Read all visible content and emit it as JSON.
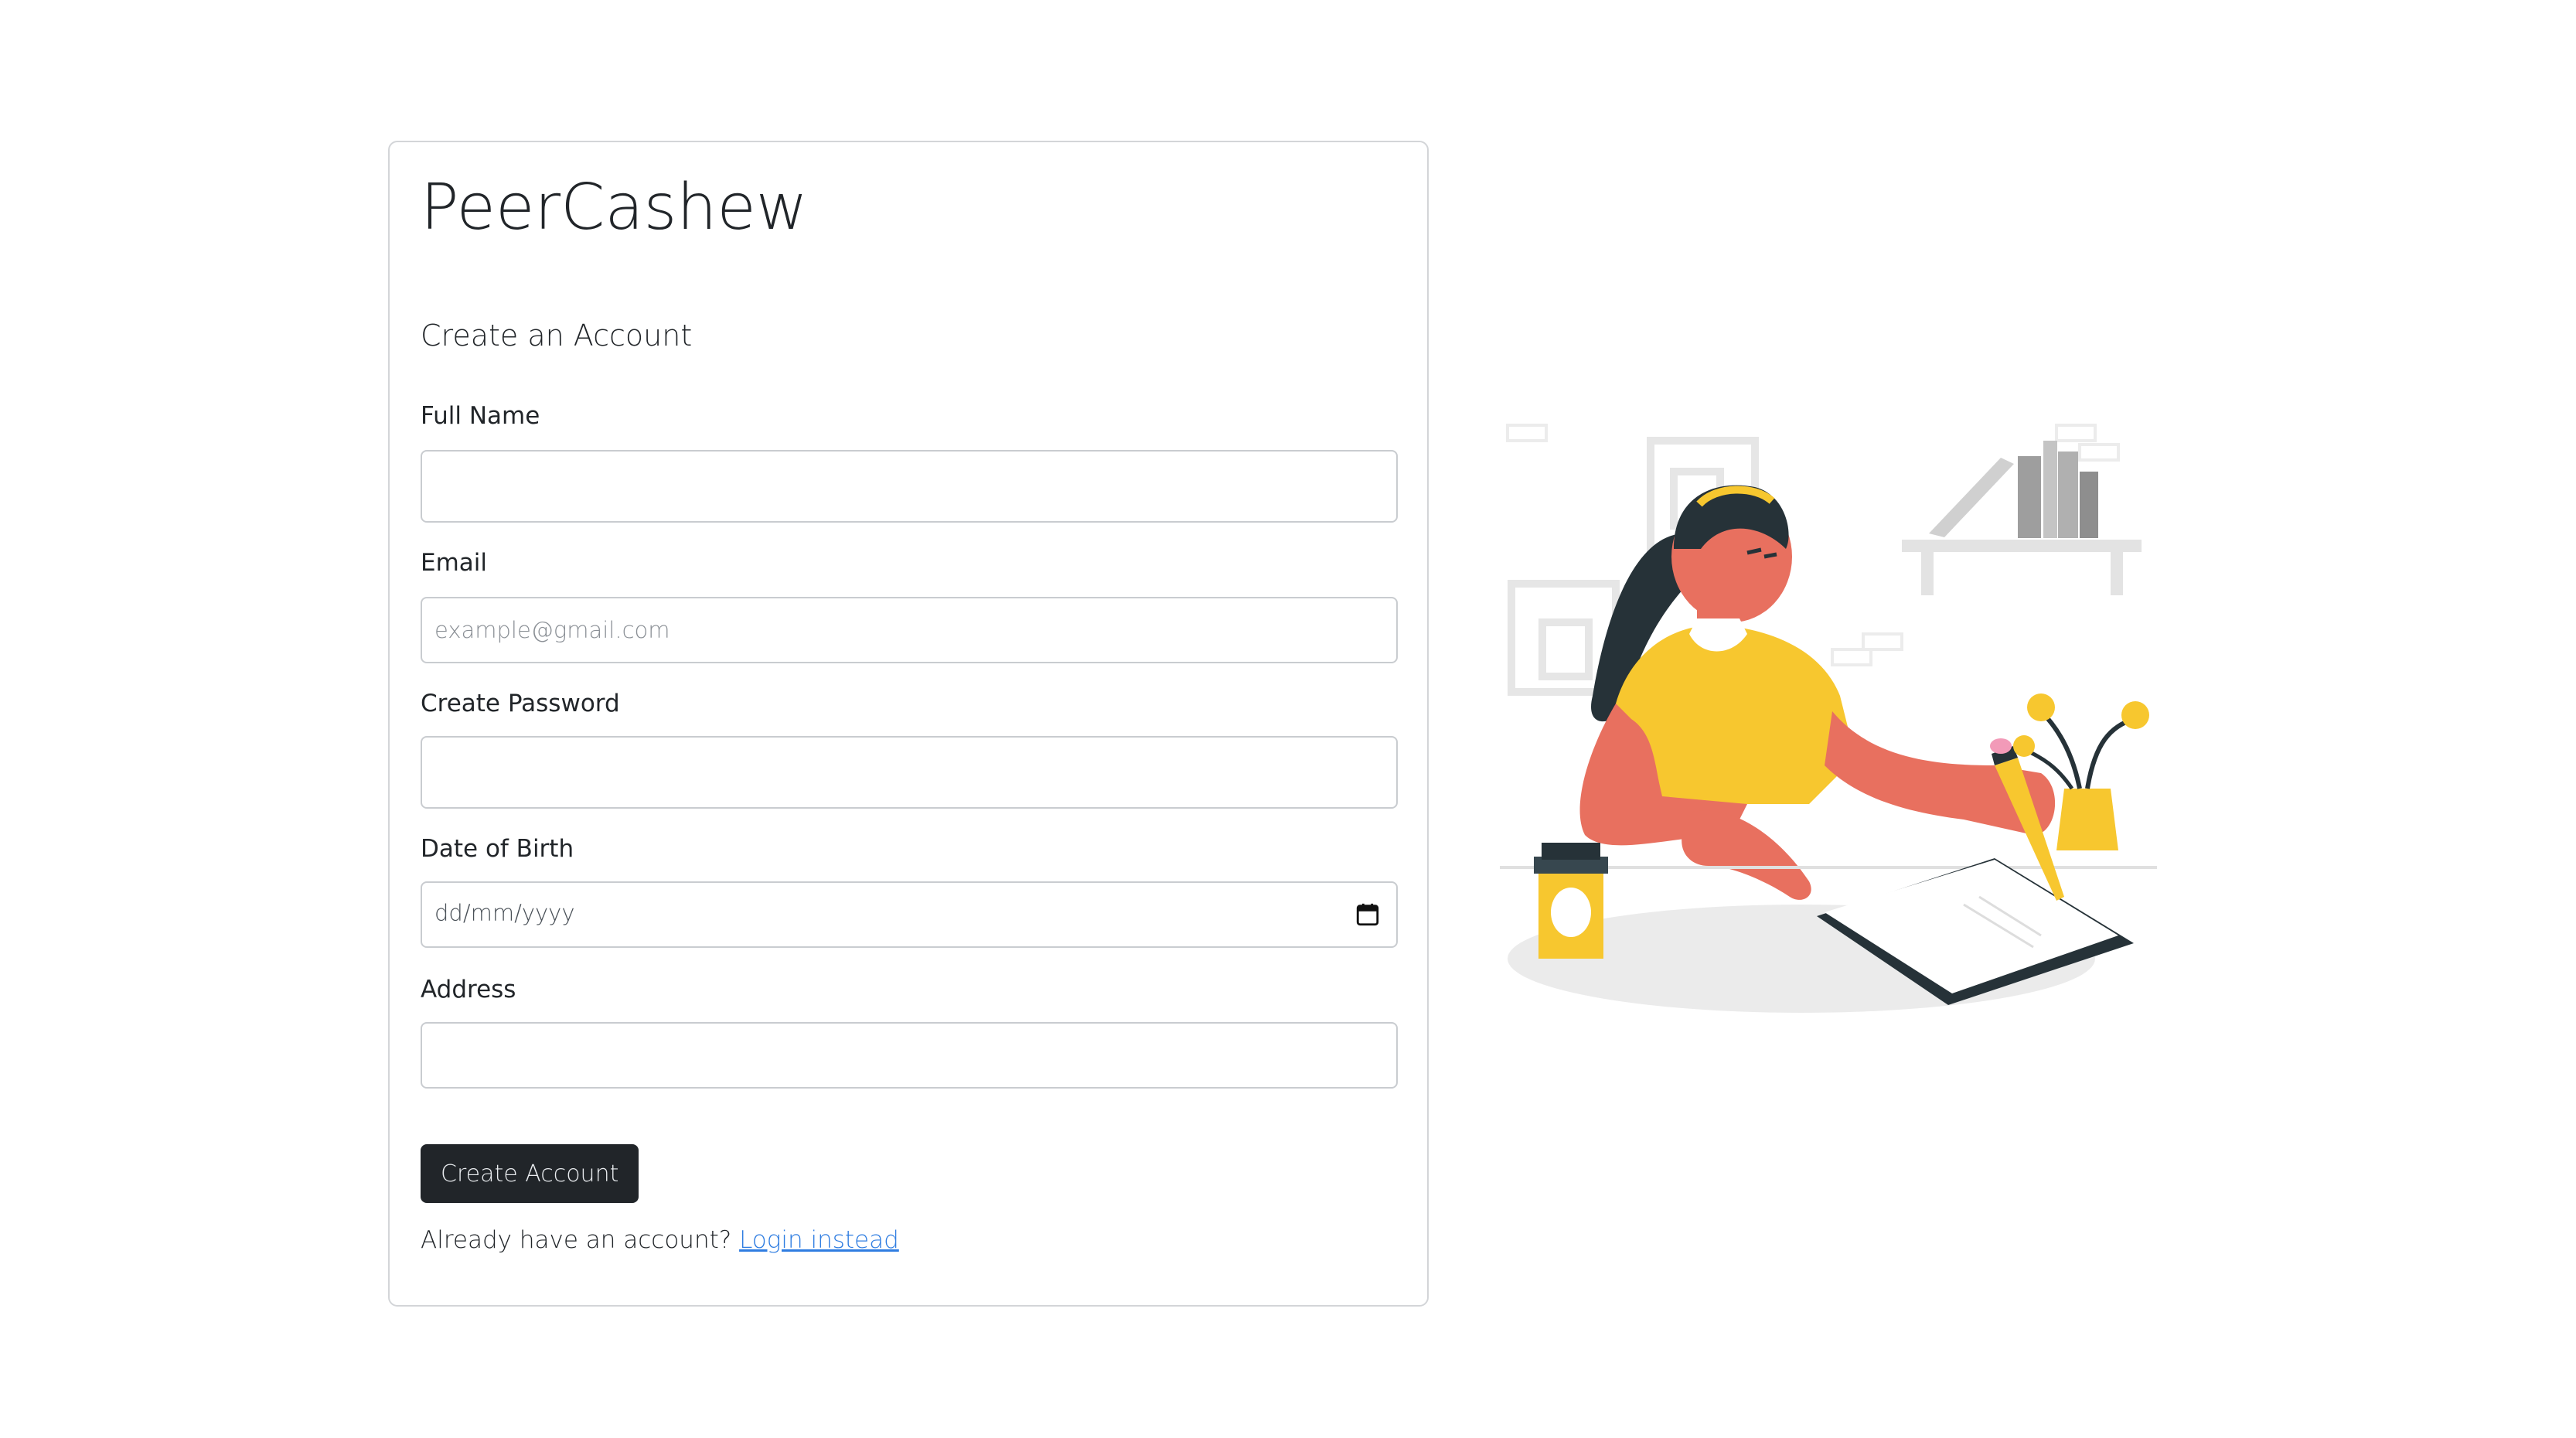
{
  "app": {
    "brand": "PeerCashew",
    "heading": "Create an Account"
  },
  "form": {
    "full_name": {
      "label": "Full Name",
      "value": "",
      "placeholder": ""
    },
    "email": {
      "label": "Email",
      "value": "",
      "placeholder": "example@gmail.com"
    },
    "password": {
      "label": "Create Password",
      "value": "",
      "placeholder": ""
    },
    "dob": {
      "label": "Date of Birth",
      "placeholder": "dd/mm/yyyy"
    },
    "address": {
      "label": "Address",
      "value": "",
      "placeholder": ""
    },
    "submit_label": "Create Account"
  },
  "footer": {
    "prompt": "Already have an account?",
    "link_label": "Login instead"
  },
  "colors": {
    "button_bg": "#212529",
    "link": "#2f7de1",
    "illustration_yellow": "#f7c72f",
    "illustration_skin": "#e8705f",
    "illustration_dark": "#263238"
  },
  "icons": {
    "calendar": "calendar-icon"
  }
}
